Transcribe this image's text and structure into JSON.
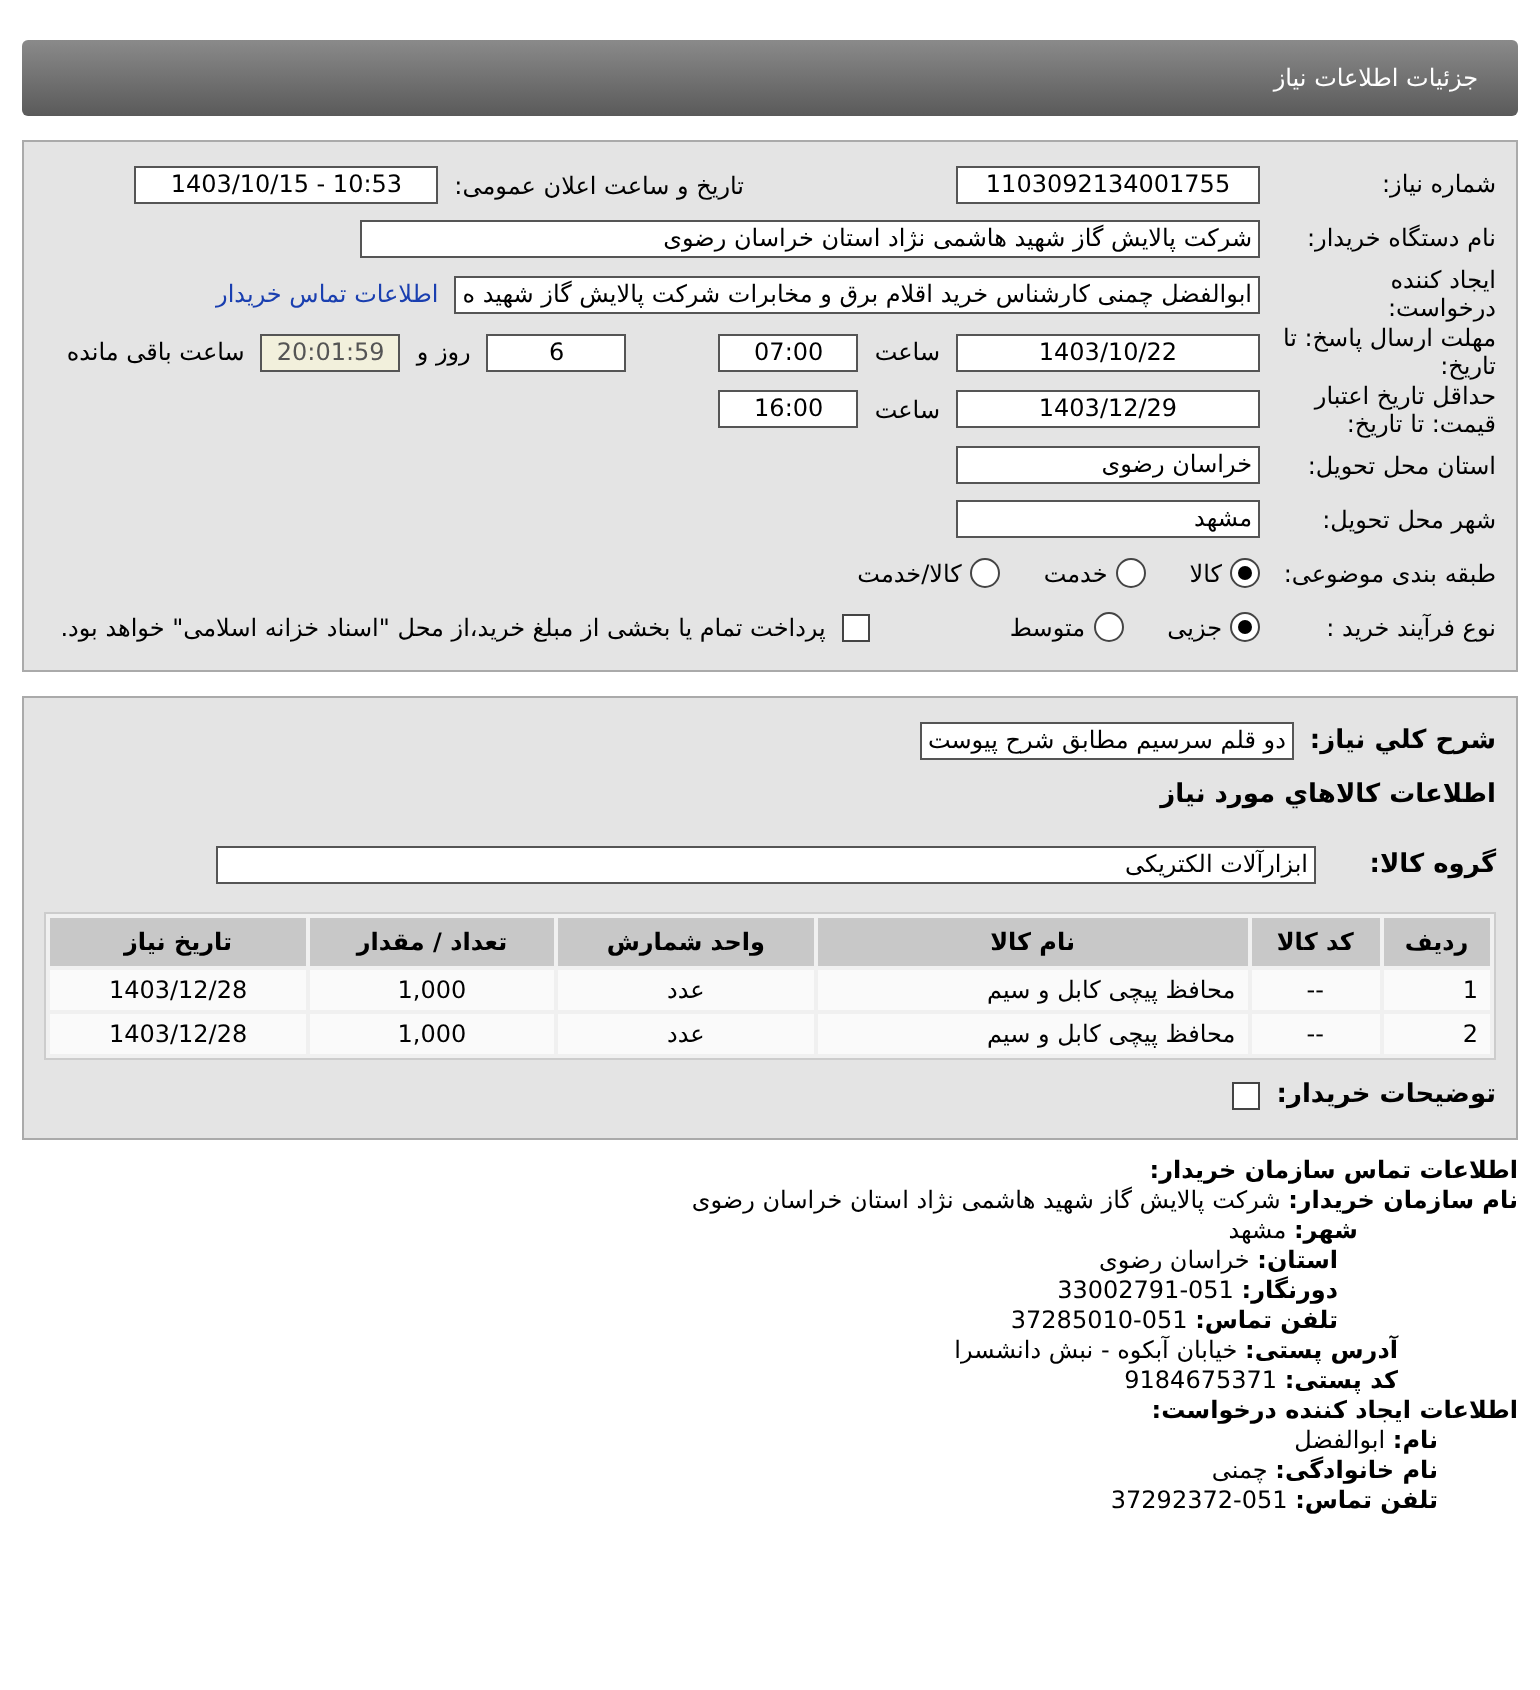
{
  "header": {
    "title": "جزئیات اطلاعات نیاز"
  },
  "need_number": {
    "label": "شماره نیاز:",
    "value": "1103092134001755"
  },
  "announce": {
    "label": "تاریخ و ساعت اعلان عمومی:",
    "value": "1403/10/15 - 10:53"
  },
  "buyer_org": {
    "label": "نام دستگاه خریدار:",
    "value": "شرکت پالایش گاز شهید هاشمی نژاد   استان خراسان رضوی"
  },
  "requester": {
    "label": "ایجاد کننده درخواست:",
    "value": "ابوالفضل چمنی کارشناس خرید اقلام برق و مخابرات شرکت پالایش گاز شهید ه",
    "link": "اطلاعات تماس خریدار"
  },
  "deadline": {
    "label": "مهلت ارسال پاسخ: تا تاریخ:",
    "date": "1403/10/22",
    "time_label": "ساعت",
    "time": "07:00",
    "days": "6",
    "days_label": "روز و",
    "remaining": "20:01:59",
    "remaining_label": "ساعت باقی مانده"
  },
  "validity": {
    "label": "حداقل تاریخ اعتبار قیمت: تا تاریخ:",
    "date": "1403/12/29",
    "time_label": "ساعت",
    "time": "16:00"
  },
  "province": {
    "label": "استان محل تحویل:",
    "value": "خراسان رضوی"
  },
  "city": {
    "label": "شهر محل تحویل:",
    "value": "مشهد"
  },
  "category": {
    "label": "طبقه بندی موضوعی:",
    "options": [
      {
        "label": "کالا",
        "selected": true
      },
      {
        "label": "خدمت",
        "selected": false
      },
      {
        "label": "کالا/خدمت",
        "selected": false
      }
    ]
  },
  "process": {
    "label": "نوع فرآیند خرید :",
    "options": [
      {
        "label": "جزیی",
        "selected": true
      },
      {
        "label": "متوسط",
        "selected": false
      }
    ],
    "payment": {
      "label": "پرداخت تمام یا بخشی از مبلغ خرید،از محل \"اسناد خزانه اسلامی\" خواهد بود.",
      "checked": false
    }
  },
  "description": {
    "label": "شرح كلي نياز:",
    "value": "دو قلم سرسیم مطابق شرح پیوست"
  },
  "goods_title": "اطلاعات كالاهاي مورد نياز",
  "goods_group": {
    "label": "گروه کالا:",
    "value": "ابزارآلات الکتریکی"
  },
  "table": {
    "columns": [
      "ردیف",
      "کد کالا",
      "نام کالا",
      "واحد شمارش",
      "تعداد / مقدار",
      "تاریخ نیاز"
    ],
    "rows": [
      [
        "1",
        "--",
        "محافظ پیچی کابل و سیم",
        "عدد",
        "1,000",
        "1403/12/28"
      ],
      [
        "2",
        "--",
        "محافظ پیچی کابل و سیم",
        "عدد",
        "1,000",
        "1403/12/28"
      ]
    ]
  },
  "buyer_notes": {
    "label": "توضیحات خریدار:",
    "checked": false
  },
  "contact": {
    "title": "اطلاعات تماس سازمان خریدار:",
    "lines": [
      {
        "label": "نام سازمان خریدار:",
        "value": "شرکت پالایش گاز شهید هاشمی نژاد استان خراسان رضوی"
      },
      {
        "label": "شهر:",
        "value": "مشهد"
      },
      {
        "label": "استان:",
        "value": "خراسان رضوی"
      },
      {
        "label": "دورنگار:",
        "value": "051-33002791"
      },
      {
        "label": "تلفن تماس:",
        "value": "051-37285010"
      },
      {
        "label": "آدرس پستی:",
        "value": "خیابان آبکوه - نبش دانشسرا"
      },
      {
        "label": "کد پستی:",
        "value": "9184675371"
      }
    ],
    "creator_title": "اطلاعات ایجاد کننده درخواست:",
    "creator_lines": [
      {
        "label": "نام:",
        "value": "ابوالفضل"
      },
      {
        "label": "نام خانوادگی:",
        "value": "چمنی"
      },
      {
        "label": "تلفن تماس:",
        "value": "051-37292372"
      }
    ]
  }
}
